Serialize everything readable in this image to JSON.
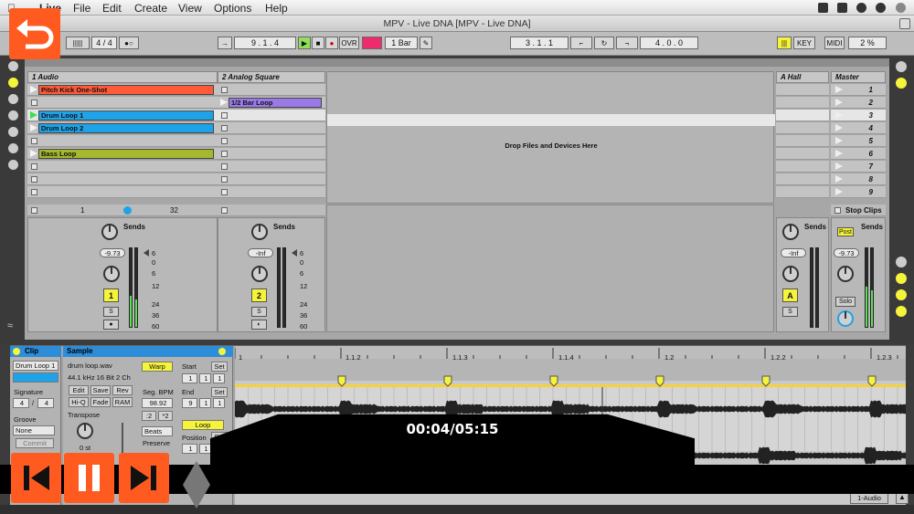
{
  "menubar": {
    "items": [
      "Live",
      "File",
      "Edit",
      "Create",
      "View",
      "Options",
      "Help"
    ]
  },
  "window": {
    "title": "MPV - Live DNA  [MPV - Live DNA]"
  },
  "transport": {
    "time_sig": "4 / 4",
    "position": "9 .  1 .  4",
    "ovr": "OVR",
    "quantize": "1 Bar",
    "loop_start": "3 .  1 .  1",
    "loop_length": "4 .  0 .  0",
    "key": "KEY",
    "midi": "MIDI",
    "cpu": "2 %"
  },
  "session": {
    "tracks": [
      {
        "name": "1 Audio"
      },
      {
        "name": "2 Analog Square"
      },
      {
        "name": "A Hall"
      },
      {
        "name": "Master"
      }
    ],
    "track1_clips": [
      "Pitch Kick One-Shot",
      "",
      "Drum Loop 1",
      "Drum Loop 2",
      "",
      "Bass Loop"
    ],
    "track2_clips": [
      "",
      "1/2 Bar Loop"
    ],
    "drop_text": "Drop Files and Devices Here",
    "scenes": [
      "1",
      "2",
      "3",
      "4",
      "5",
      "6",
      "7",
      "8",
      "9"
    ],
    "stop_clips": "Stop Clips",
    "sends_label": "Sends",
    "post_label": "Post",
    "scroll_min": "1",
    "scroll_max": "32",
    "mixer": {
      "t1_vol": "-9.73",
      "t2_vol": "-Inf",
      "ret_vol": "-Inf",
      "master_vol": "-9.73",
      "t1_num": "1",
      "t2_num": "2",
      "ret_letter": "A",
      "solo": "S",
      "solo_label": "Solo",
      "db_scale": [
        "6",
        "0",
        "6",
        "12",
        "24",
        "36",
        "60"
      ]
    }
  },
  "detail": {
    "clip_panel_title": "Clip",
    "clip_name": "Drum Loop 1",
    "signature_label": "Signature",
    "sig_num": "4",
    "sig_den": "4",
    "groove_label": "Groove",
    "groove_value": "None",
    "commit": "Commit",
    "sample_panel_title": "Sample",
    "sample_file": "drum loop.wav",
    "sample_info": "44.1 kHz 16 Bit 2 Ch",
    "btns": [
      "Edit",
      "Save",
      "Rev",
      "Hi-Q",
      "Fade",
      "RAM"
    ],
    "transpose_label": "Transpose",
    "transpose_value": "0 st",
    "warp": "Warp",
    "seg_bpm_label": "Seg. BPM",
    "seg_bpm": "98.92",
    "half": ":2",
    "double": "*2",
    "warp_mode": "Beats",
    "preserve_label": "Preserve",
    "start_label": "Start",
    "end_label": "End",
    "set": "Set",
    "start_vals": [
      "1",
      "1",
      "1"
    ],
    "end_vals": [
      "9",
      "1",
      "1"
    ],
    "loop": "Loop",
    "position_label": "Position",
    "position_vals": [
      "1",
      "1"
    ],
    "ruler": [
      "1",
      "1.1.2",
      "1.1.3",
      "1.1.4",
      "1.2",
      "1.2.2",
      "1.2.3"
    ],
    "output": "1-Audio"
  },
  "player": {
    "time": "00:04/05:15"
  },
  "colors": {
    "pitch_kick": "#ff5a3a",
    "drum_loop": "#1fa3e8",
    "bass_loop": "#a6b82c",
    "half_bar": "#9a7ae8",
    "accent": "#f5f43a",
    "player": "#ff5a1f"
  }
}
